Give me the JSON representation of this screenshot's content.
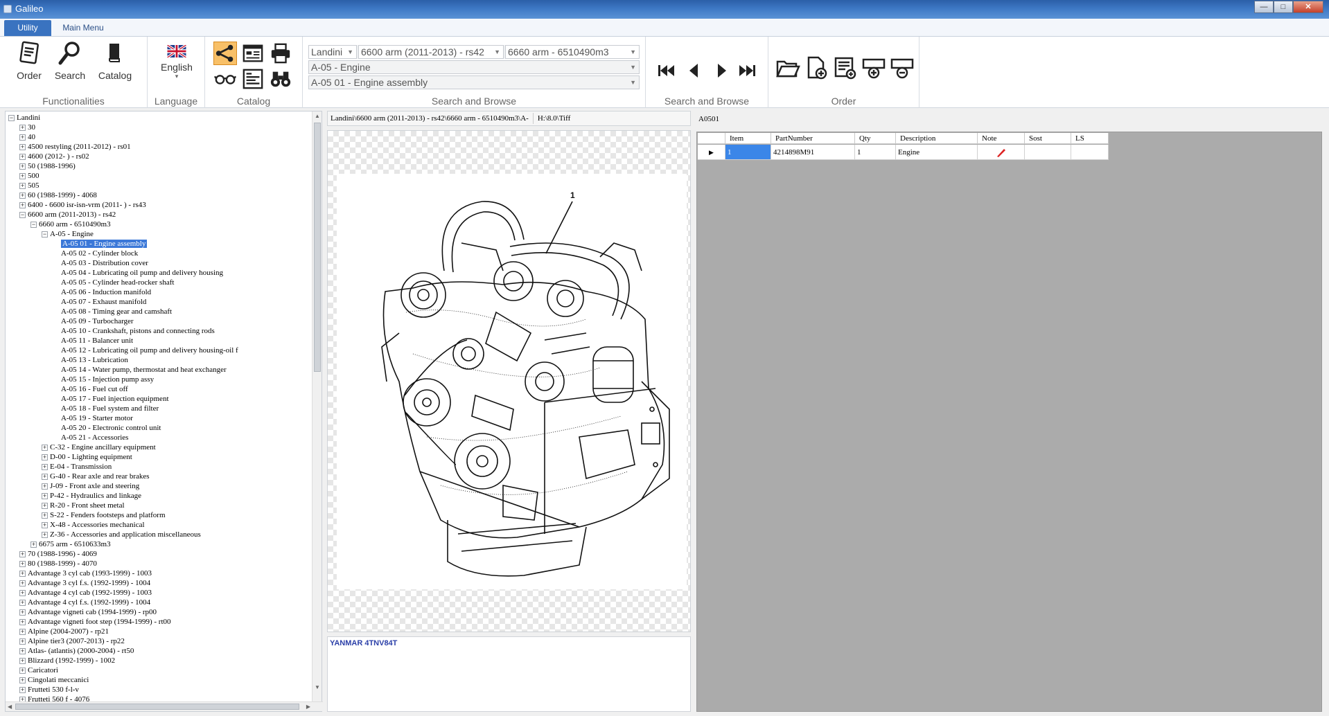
{
  "window": {
    "title": "Galileo",
    "minimize": "—",
    "maximize": "□",
    "close": "✕"
  },
  "ribbon_tabs": [
    {
      "label": "Utility"
    },
    {
      "label": "Main Menu"
    }
  ],
  "ribbon": {
    "functionalities": {
      "label": "Functionalities",
      "order": "Order",
      "search": "Search",
      "catalog": "Catalog"
    },
    "language": {
      "label": "Language",
      "value": "English",
      "caret": "▾"
    },
    "catalog_group": {
      "label": "Catalog"
    },
    "search_browse_combos": {
      "label": "Search and Browse",
      "combo1": "Landini",
      "combo2": "6600 arm (2011-2013) - rs42",
      "combo3": "6660 arm - 6510490m3",
      "combo4": "A-05 - Engine",
      "combo5": "A-05 01 - Engine assembly"
    },
    "search_browse_nav": {
      "label": "Search and Browse"
    },
    "order_group": {
      "label": "Order"
    }
  },
  "tree": {
    "rows": [
      {
        "lvl": 0,
        "t": "-",
        "label": "Landini"
      },
      {
        "lvl": 1,
        "t": "+",
        "label": "30"
      },
      {
        "lvl": 1,
        "t": "+",
        "label": "40"
      },
      {
        "lvl": 1,
        "t": "+",
        "label": "4500 restyling (2011-2012) - rs01"
      },
      {
        "lvl": 1,
        "t": "+",
        "label": "4600 (2012-    ) - rs02"
      },
      {
        "lvl": 1,
        "t": "+",
        "label": "50 (1988-1996)"
      },
      {
        "lvl": 1,
        "t": "+",
        "label": "500"
      },
      {
        "lvl": 1,
        "t": "+",
        "label": "505"
      },
      {
        "lvl": 1,
        "t": "+",
        "label": "60 (1988-1999) - 4068"
      },
      {
        "lvl": 1,
        "t": "+",
        "label": "6400 - 6600  isr-isn-vrm (2011-    ) - rs43"
      },
      {
        "lvl": 1,
        "t": "-",
        "label": "6600 arm (2011-2013) - rs42"
      },
      {
        "lvl": 2,
        "t": "-",
        "label": "6660 arm - 6510490m3"
      },
      {
        "lvl": 3,
        "t": "-",
        "label": "A-05 - Engine"
      },
      {
        "lvl": 4,
        "t": "",
        "label": "A-05 01 - Engine assembly",
        "sel": true
      },
      {
        "lvl": 4,
        "t": "",
        "label": "A-05 02 - Cylinder block"
      },
      {
        "lvl": 4,
        "t": "",
        "label": "A-05 03 - Distribution cover"
      },
      {
        "lvl": 4,
        "t": "",
        "label": "A-05 04 - Lubricating oil pump and delivery housing"
      },
      {
        "lvl": 4,
        "t": "",
        "label": "A-05 05 - Cylinder head-rocker shaft"
      },
      {
        "lvl": 4,
        "t": "",
        "label": "A-05 06 - Induction manifold"
      },
      {
        "lvl": 4,
        "t": "",
        "label": "A-05 07 - Exhaust manifold"
      },
      {
        "lvl": 4,
        "t": "",
        "label": "A-05 08 - Timing gear and camshaft"
      },
      {
        "lvl": 4,
        "t": "",
        "label": "A-05 09 - Turbocharger"
      },
      {
        "lvl": 4,
        "t": "",
        "label": "A-05 10 - Crankshaft, pistons and connecting rods"
      },
      {
        "lvl": 4,
        "t": "",
        "label": "A-05 11 - Balancer unit"
      },
      {
        "lvl": 4,
        "t": "",
        "label": "A-05 12 - Lubricating oil pump and delivery housing-oil f"
      },
      {
        "lvl": 4,
        "t": "",
        "label": "A-05 13 - Lubrication"
      },
      {
        "lvl": 4,
        "t": "",
        "label": "A-05 14 - Water pump, thermostat and heat exchanger"
      },
      {
        "lvl": 4,
        "t": "",
        "label": "A-05 15 - Injection pump assy"
      },
      {
        "lvl": 4,
        "t": "",
        "label": "A-05 16 - Fuel cut off"
      },
      {
        "lvl": 4,
        "t": "",
        "label": "A-05 17 - Fuel injection equipment"
      },
      {
        "lvl": 4,
        "t": "",
        "label": "A-05 18 - Fuel system and filter"
      },
      {
        "lvl": 4,
        "t": "",
        "label": "A-05 19 - Starter motor"
      },
      {
        "lvl": 4,
        "t": "",
        "label": "A-05 20 - Electronic control unit"
      },
      {
        "lvl": 4,
        "t": "",
        "label": "A-05 21 - Accessories"
      },
      {
        "lvl": 3,
        "t": "+",
        "label": "C-32 - Engine ancillary equipment"
      },
      {
        "lvl": 3,
        "t": "+",
        "label": "D-00 - Lighting equipment"
      },
      {
        "lvl": 3,
        "t": "+",
        "label": "E-04 - Transmission"
      },
      {
        "lvl": 3,
        "t": "+",
        "label": "G-40 - Rear axle and rear brakes"
      },
      {
        "lvl": 3,
        "t": "+",
        "label": "J-09 - Front axle and steering"
      },
      {
        "lvl": 3,
        "t": "+",
        "label": "P-42 - Hydraulics and linkage"
      },
      {
        "lvl": 3,
        "t": "+",
        "label": "R-20 - Front sheet metal"
      },
      {
        "lvl": 3,
        "t": "+",
        "label": "S-22 - Fenders footsteps and platform"
      },
      {
        "lvl": 3,
        "t": "+",
        "label": "X-48 - Accessories mechanical"
      },
      {
        "lvl": 3,
        "t": "+",
        "label": "Z-36 - Accessories and application miscellaneous"
      },
      {
        "lvl": 2,
        "t": "+",
        "label": "6675 arm - 6510633m3"
      },
      {
        "lvl": 1,
        "t": "+",
        "label": "70 (1988-1996) - 4069"
      },
      {
        "lvl": 1,
        "t": "+",
        "label": "80 (1988-1999) - 4070"
      },
      {
        "lvl": 1,
        "t": "+",
        "label": "Advantage 3 cyl cab (1993-1999) - 1003"
      },
      {
        "lvl": 1,
        "t": "+",
        "label": "Advantage 3 cyl f.s. (1992-1999) - 1004"
      },
      {
        "lvl": 1,
        "t": "+",
        "label": "Advantage 4 cyl cab (1992-1999) - 1003"
      },
      {
        "lvl": 1,
        "t": "+",
        "label": "Advantage 4 cyl f.s. (1992-1999) - 1004"
      },
      {
        "lvl": 1,
        "t": "+",
        "label": "Advantage vigneti cab (1994-1999) - rp00"
      },
      {
        "lvl": 1,
        "t": "+",
        "label": "Advantage vigneti foot step (1994-1999) - rt00"
      },
      {
        "lvl": 1,
        "t": "+",
        "label": "Alpine (2004-2007) - rp21"
      },
      {
        "lvl": 1,
        "t": "+",
        "label": "Alpine tier3 (2007-2013) - rp22"
      },
      {
        "lvl": 1,
        "t": "+",
        "label": "Atlas- (atlantis) (2000-2004) - rt50"
      },
      {
        "lvl": 1,
        "t": "+",
        "label": "Blizzard (1992-1999) - 1002"
      },
      {
        "lvl": 1,
        "t": "+",
        "label": "Caricatori"
      },
      {
        "lvl": 1,
        "t": "+",
        "label": "Cingolati meccanici"
      },
      {
        "lvl": 1,
        "t": "+",
        "label": "Frutteti 530 f-l-v"
      },
      {
        "lvl": 1,
        "t": "+",
        "label": "Frutteti 560 f - 4076"
      }
    ]
  },
  "path_bar": {
    "path": "Landini\\6600 arm (2011-2013) - rs42\\6660 arm - 6510490m3\\A-",
    "file": "H:\\8.0\\Tiff"
  },
  "drawing": {
    "callout": "1"
  },
  "note": {
    "text": "YANMAR 4TNV84T"
  },
  "grid": {
    "code": "A0501",
    "columns": [
      "Item",
      "PartNumber",
      "Qty",
      "Description",
      "Note",
      "Sost",
      "LS"
    ],
    "rows": [
      {
        "item": "1",
        "part_number": "4214898M91",
        "qty": "1",
        "description": "Engine",
        "note": "",
        "sost": "",
        "ls": ""
      }
    ]
  },
  "colors": {
    "accent": "#3a73c0",
    "selection": "#3b78d8",
    "highlight_icon": "#f8c068"
  }
}
